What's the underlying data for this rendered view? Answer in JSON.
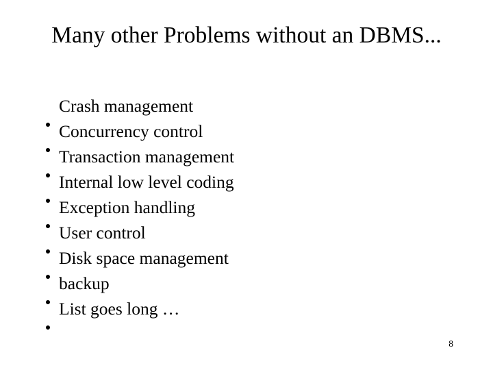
{
  "slide": {
    "title": "Many other Problems without an DBMS...",
    "title_line_1": "Many other Problems without an",
    "title_line_2": "DBMS...",
    "bullet_glyph": "•",
    "bullets": [
      {
        "label": "Crash management"
      },
      {
        "label": "Concurrency control"
      },
      {
        "label": "Transaction management"
      },
      {
        "label": "Internal low level coding"
      },
      {
        "label": "Exception handling"
      },
      {
        "label": "User control"
      },
      {
        "label": "Disk space management"
      },
      {
        "label": "backup"
      },
      {
        "label": "List goes long …"
      }
    ],
    "page_number": "8",
    "colors": {
      "background": "#ffffff",
      "text": "#000000"
    }
  }
}
